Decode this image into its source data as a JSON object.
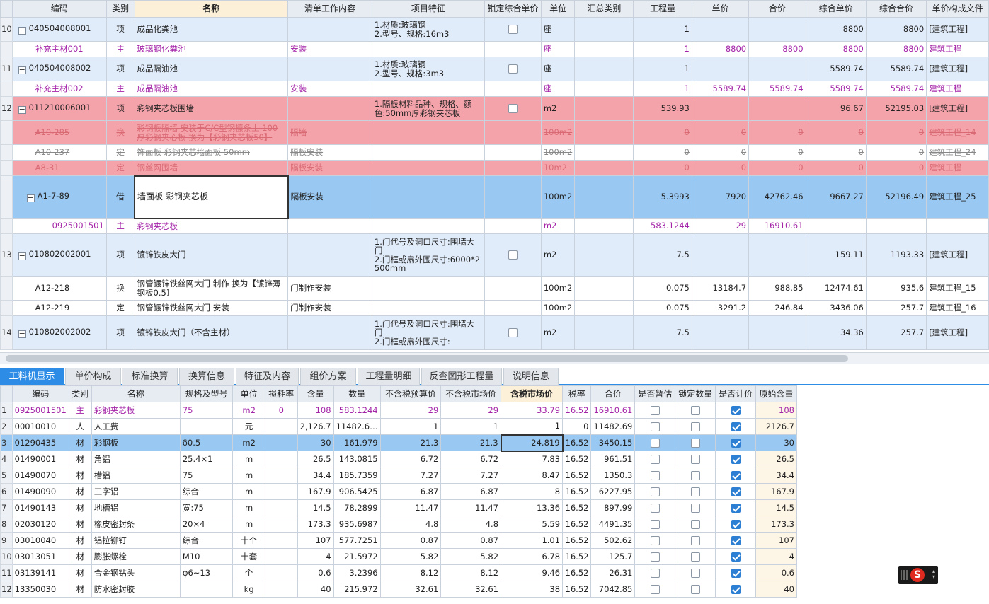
{
  "top_grid": {
    "headers": [
      "编码",
      "类别",
      "名称",
      "清单工作内容",
      "项目特征",
      "锁定综合单价",
      "单位",
      "汇总类别",
      "工程量",
      "单价",
      "合价",
      "综合单价",
      "综合合价",
      "单价构成文件"
    ],
    "rows": [
      {
        "num": "10",
        "code": "040504008001",
        "cat": "项",
        "name": "成品化粪池",
        "work": "",
        "feature": "1.材质:玻璃钢\n2.型号、规格:16m3",
        "lock": false,
        "unit": "座",
        "sum": "",
        "qty": "1",
        "price": "",
        "total": "",
        "uprice": "8800",
        "utotal": "8800",
        "file": "[建筑工程]"
      },
      {
        "num": "",
        "code": "补充主材001",
        "cat": "主",
        "name": "玻璃钢化粪池",
        "work": "安装",
        "feature": "",
        "unit": "座",
        "sum": "",
        "qty": "1",
        "price": "8800",
        "total": "8800",
        "uprice": "8800",
        "utotal": "8800",
        "file": "建筑工程"
      },
      {
        "num": "11",
        "code": "040504008002",
        "cat": "项",
        "name": "成品隔油池",
        "work": "",
        "feature": "1.材质:玻璃钢\n2.型号、规格:3m3",
        "lock": false,
        "unit": "座",
        "sum": "",
        "qty": "1",
        "price": "",
        "total": "",
        "uprice": "5589.74",
        "utotal": "5589.74",
        "file": "[建筑工程]"
      },
      {
        "num": "",
        "code": "补充主材002",
        "cat": "主",
        "name": "成品隔油池",
        "work": "安装",
        "feature": "",
        "unit": "座",
        "sum": "",
        "qty": "1",
        "price": "5589.74",
        "total": "5589.74",
        "uprice": "5589.74",
        "utotal": "5589.74",
        "file": "建筑工程"
      },
      {
        "num": "12",
        "code": "011210006001",
        "cat": "项",
        "name": "彩钢夹芯板围墙",
        "work": "",
        "feature": "1.隔板材料品种、规格、颜色:50mm厚彩钢夹芯板",
        "lock": false,
        "unit": "m2",
        "sum": "",
        "qty": "539.93",
        "price": "",
        "total": "",
        "uprice": "96.67",
        "utotal": "52195.03",
        "file": "[建筑工程]"
      },
      {
        "num": "",
        "code": "A10-285",
        "cat": "换",
        "name": "彩钢板隔墙 安装于C/C型钢檩条上 100厚彩钢夹心板 换为【彩钢夹芯板50】",
        "work": "隔墙",
        "feature": "",
        "unit": "100m2",
        "sum": "",
        "qty": "0",
        "price": "0",
        "total": "0",
        "uprice": "0",
        "utotal": "0",
        "file": "建筑工程_14"
      },
      {
        "num": "",
        "code": "A10-237",
        "cat": "定",
        "name": "饰面板 彩钢夹芯墙面板 50mm",
        "work": "隔板安装",
        "feature": "",
        "unit": "100m2",
        "sum": "",
        "qty": "0",
        "price": "0",
        "total": "0",
        "uprice": "0",
        "utotal": "0",
        "file": "建筑工程_24"
      },
      {
        "num": "",
        "code": "A8-31",
        "cat": "定",
        "name": "钢丝网围墙",
        "work": "隔板安装",
        "feature": "",
        "unit": "10m2",
        "sum": "",
        "qty": "0",
        "price": "0",
        "total": "0",
        "uprice": "0",
        "utotal": "0",
        "file": "建筑工程"
      },
      {
        "num": "",
        "code": "A1-7-89",
        "cat": "借",
        "name": "墙面板 彩钢夹芯板",
        "work": "隔板安装",
        "feature": "",
        "unit": "100m2",
        "sum": "",
        "qty": "5.3993",
        "price": "7920",
        "total": "42762.46",
        "uprice": "9667.27",
        "utotal": "52196.49",
        "file": "建筑工程_25"
      },
      {
        "num": "",
        "code": "0925001501",
        "cat": "主",
        "name": "彩钢夹芯板",
        "work": "",
        "feature": "",
        "unit": "m2",
        "sum": "",
        "qty": "583.1244",
        "price": "29",
        "total": "16910.61",
        "uprice": "",
        "utotal": "",
        "file": ""
      },
      {
        "num": "13",
        "code": "010802002001",
        "cat": "项",
        "name": "镀锌铁皮大门",
        "work": "",
        "feature": "1.门代号及洞口尺寸:围墙大门\n2.门框或扇外围尺寸:6000*2500mm",
        "lock": false,
        "unit": "m2",
        "sum": "",
        "qty": "7.5",
        "price": "",
        "total": "",
        "uprice": "159.11",
        "utotal": "1193.33",
        "file": "[建筑工程]"
      },
      {
        "num": "",
        "code": "A12-218",
        "cat": "换",
        "name": "钢管镀锌铁丝网大门 制作  换为【镀锌薄钢板0.5】",
        "work": "门制作安装",
        "feature": "",
        "unit": "100m2",
        "sum": "",
        "qty": "0.075",
        "price": "13184.7",
        "total": "988.85",
        "uprice": "12474.61",
        "utotal": "935.6",
        "file": "建筑工程_15"
      },
      {
        "num": "",
        "code": "A12-219",
        "cat": "定",
        "name": "钢管镀锌铁丝网大门 安装",
        "work": "门制作安装",
        "feature": "",
        "unit": "100m2",
        "sum": "",
        "qty": "0.075",
        "price": "3291.2",
        "total": "246.84",
        "uprice": "3436.06",
        "utotal": "257.7",
        "file": "建筑工程_16"
      },
      {
        "num": "14",
        "code": "010802002002",
        "cat": "项",
        "name": "镀锌铁皮大门（不含主材）",
        "work": "",
        "feature": "1.门代号及洞口尺寸:围墙大门\n2.门框或扇外围尺寸:",
        "lock": false,
        "unit": "m2",
        "sum": "",
        "qty": "7.5",
        "price": "",
        "total": "",
        "uprice": "34.36",
        "utotal": "257.7",
        "file": "[建筑工程]"
      }
    ]
  },
  "tabs": [
    "工料机显示",
    "单价构成",
    "标准换算",
    "换算信息",
    "特征及内容",
    "组价方案",
    "工程量明细",
    "反查图形工程量",
    "说明信息"
  ],
  "active_tab": 0,
  "bottom_grid": {
    "headers": [
      "",
      "编码",
      "类别",
      "名称",
      "规格及型号",
      "单位",
      "损耗率",
      "含量",
      "数量",
      "不含税预算价",
      "不含税市场价",
      "含税市场价",
      "税率",
      "合价",
      "是否暂估",
      "锁定数量",
      "是否计价",
      "原始含量"
    ],
    "rows": [
      {
        "num": "1",
        "code": "0925001501",
        "cat": "主",
        "name": "彩钢夹芯板",
        "spec": "75",
        "unit": "m2",
        "loss": "0",
        "amt": "108",
        "qty": "583.1244",
        "pre": "29",
        "mkt": "29",
        "taxmkt": "33.79",
        "tax": "16.52",
        "total": "16910.61",
        "est": false,
        "lockq": false,
        "calc": true,
        "orig": "108"
      },
      {
        "num": "2",
        "code": "00010010",
        "cat": "人",
        "name": "人工费",
        "spec": "",
        "unit": "元",
        "loss": "",
        "amt": "2,126.7",
        "qty": "11482.6…",
        "pre": "1",
        "mkt": "1",
        "taxmkt": "1",
        "tax": "0",
        "total": "11482.69",
        "est": false,
        "lockq": false,
        "calc": true,
        "orig": "2126.7"
      },
      {
        "num": "3",
        "code": "01290435",
        "cat": "材",
        "name": "彩钢板",
        "spec": "δ0.5",
        "unit": "m2",
        "loss": "",
        "amt": "30",
        "qty": "161.979",
        "pre": "21.3",
        "mkt": "21.3",
        "taxmkt": "24.819",
        "tax": "16.52",
        "total": "3450.15",
        "est": false,
        "lockq": false,
        "calc": true,
        "orig": "30"
      },
      {
        "num": "4",
        "code": "01490001",
        "cat": "材",
        "name": "角铝",
        "spec": "25.4×1",
        "unit": "m",
        "loss": "",
        "amt": "26.5",
        "qty": "143.0815",
        "pre": "6.72",
        "mkt": "6.72",
        "taxmkt": "7.83",
        "tax": "16.52",
        "total": "961.51",
        "est": false,
        "lockq": false,
        "calc": true,
        "orig": "26.5"
      },
      {
        "num": "5",
        "code": "01490070",
        "cat": "材",
        "name": "槽铝",
        "spec": "75",
        "unit": "m",
        "loss": "",
        "amt": "34.4",
        "qty": "185.7359",
        "pre": "7.27",
        "mkt": "7.27",
        "taxmkt": "8.47",
        "tax": "16.52",
        "total": "1350.3",
        "est": false,
        "lockq": false,
        "calc": true,
        "orig": "34.4"
      },
      {
        "num": "6",
        "code": "01490090",
        "cat": "材",
        "name": "工字铝",
        "spec": "综合",
        "unit": "m",
        "loss": "",
        "amt": "167.9",
        "qty": "906.5425",
        "pre": "6.87",
        "mkt": "6.87",
        "taxmkt": "8",
        "tax": "16.52",
        "total": "6227.95",
        "est": false,
        "lockq": false,
        "calc": true,
        "orig": "167.9"
      },
      {
        "num": "7",
        "code": "01490143",
        "cat": "材",
        "name": "地槽铝",
        "spec": "宽:75",
        "unit": "m",
        "loss": "",
        "amt": "14.5",
        "qty": "78.2899",
        "pre": "11.47",
        "mkt": "11.47",
        "taxmkt": "13.36",
        "tax": "16.52",
        "total": "897.99",
        "est": false,
        "lockq": false,
        "calc": true,
        "orig": "14.5"
      },
      {
        "num": "8",
        "code": "02030120",
        "cat": "材",
        "name": "橡皮密封条",
        "spec": "20×4",
        "unit": "m",
        "loss": "",
        "amt": "173.3",
        "qty": "935.6987",
        "pre": "4.8",
        "mkt": "4.8",
        "taxmkt": "5.59",
        "tax": "16.52",
        "total": "4491.35",
        "est": false,
        "lockq": false,
        "calc": true,
        "orig": "173.3"
      },
      {
        "num": "9",
        "code": "03010040",
        "cat": "材",
        "name": "铝拉铆钉",
        "spec": "综合",
        "unit": "十个",
        "loss": "",
        "amt": "107",
        "qty": "577.7251",
        "pre": "0.87",
        "mkt": "0.87",
        "taxmkt": "1.01",
        "tax": "16.52",
        "total": "502.62",
        "est": false,
        "lockq": false,
        "calc": true,
        "orig": "107"
      },
      {
        "num": "10",
        "code": "03013051",
        "cat": "材",
        "name": "膨胀螺栓",
        "spec": "M10",
        "unit": "十套",
        "loss": "",
        "amt": "4",
        "qty": "21.5972",
        "pre": "5.82",
        "mkt": "5.82",
        "taxmkt": "6.78",
        "tax": "16.52",
        "total": "125.7",
        "est": false,
        "lockq": false,
        "calc": true,
        "orig": "4"
      },
      {
        "num": "11",
        "code": "03139141",
        "cat": "材",
        "name": "合金钢钻头",
        "spec": "φ6~13",
        "unit": "个",
        "loss": "",
        "amt": "0.6",
        "qty": "3.2396",
        "pre": "8.12",
        "mkt": "8.12",
        "taxmkt": "9.46",
        "tax": "16.52",
        "total": "26.31",
        "est": false,
        "lockq": false,
        "calc": true,
        "orig": "0.6"
      },
      {
        "num": "12",
        "code": "13350030",
        "cat": "材",
        "name": "防水密封胶",
        "spec": "",
        "unit": "kg",
        "loss": "",
        "amt": "40",
        "qty": "215.972",
        "pre": "32.61",
        "mkt": "32.61",
        "taxmkt": "38",
        "tax": "16.52",
        "total": "7042.85",
        "est": false,
        "lockq": false,
        "calc": true,
        "orig": "40"
      }
    ]
  },
  "logo_letter": "S",
  "colors": {
    "accent": "#2d8ce6",
    "main_row": "#e1ecfa",
    "deleted_row": "#f5a3aa",
    "selected_row": "#99c8f2",
    "material_text": "#a424a8"
  }
}
